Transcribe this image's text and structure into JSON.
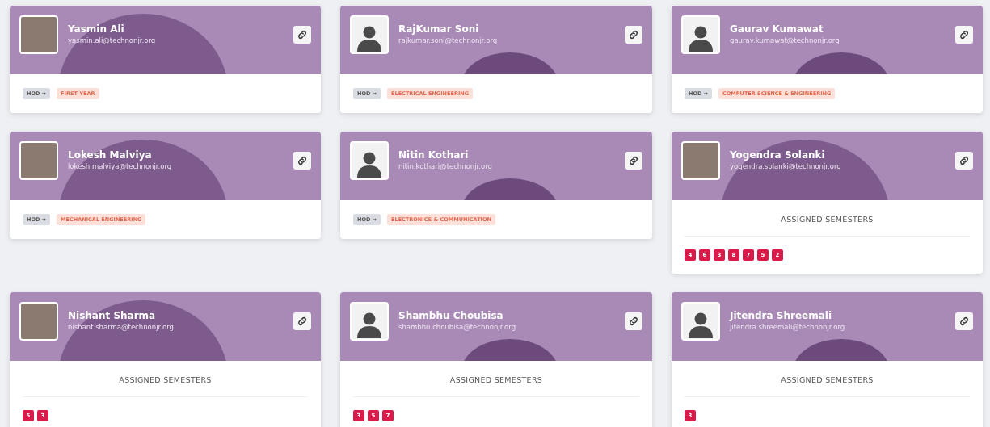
{
  "cards": [
    {
      "name": "Yasmin Ali",
      "email": "yasmin.ali@technonjr.org",
      "has_photo": true,
      "kind": "hod",
      "role": "HOD →",
      "department": "FIRST YEAR"
    },
    {
      "name": "RajKumar Soni",
      "email": "rajkumar.soni@technonjr.org",
      "has_photo": false,
      "kind": "hod",
      "role": "HOD →",
      "department": "ELECTRICAL ENGINEERING"
    },
    {
      "name": "Gaurav Kumawat",
      "email": "gaurav.kumawat@technonjr.org",
      "has_photo": false,
      "kind": "hod",
      "role": "HOD →",
      "department": "COMPUTER SCIENCE & ENGINEERING"
    },
    {
      "name": "Lokesh Malviya",
      "email": "lokesh.malviya@technonjr.org",
      "has_photo": true,
      "kind": "hod",
      "role": "HOD →",
      "department": "MECHANICAL ENGINEERING"
    },
    {
      "name": "Nitin Kothari",
      "email": "nitin.kothari@technonjr.org",
      "has_photo": false,
      "kind": "hod",
      "role": "HOD →",
      "department": "ELECTRONICS & COMMUNICATION"
    },
    {
      "name": "Yogendra Solanki",
      "email": "yogendra.solanki@technonjr.org",
      "has_photo": true,
      "kind": "semesters",
      "title": "ASSIGNED SEMESTERS",
      "semesters": [
        "4",
        "6",
        "3",
        "8",
        "7",
        "5",
        "2"
      ]
    },
    {
      "name": "Nishant Sharma",
      "email": "nishant.sharma@technonjr.org",
      "has_photo": true,
      "kind": "semesters",
      "title": "ASSIGNED SEMESTERS",
      "semesters": [
        "5",
        "3"
      ]
    },
    {
      "name": "Shambhu Choubisa",
      "email": "shambhu.choubisa@technonjr.org",
      "has_photo": false,
      "kind": "semesters",
      "title": "ASSIGNED SEMESTERS",
      "semesters": [
        "3",
        "5",
        "7"
      ]
    },
    {
      "name": "Jitendra Shreemali",
      "email": "jitendra.shreemali@technonjr.org",
      "has_photo": false,
      "kind": "semesters",
      "title": "ASSIGNED SEMESTERS",
      "semesters": [
        "3"
      ]
    }
  ]
}
